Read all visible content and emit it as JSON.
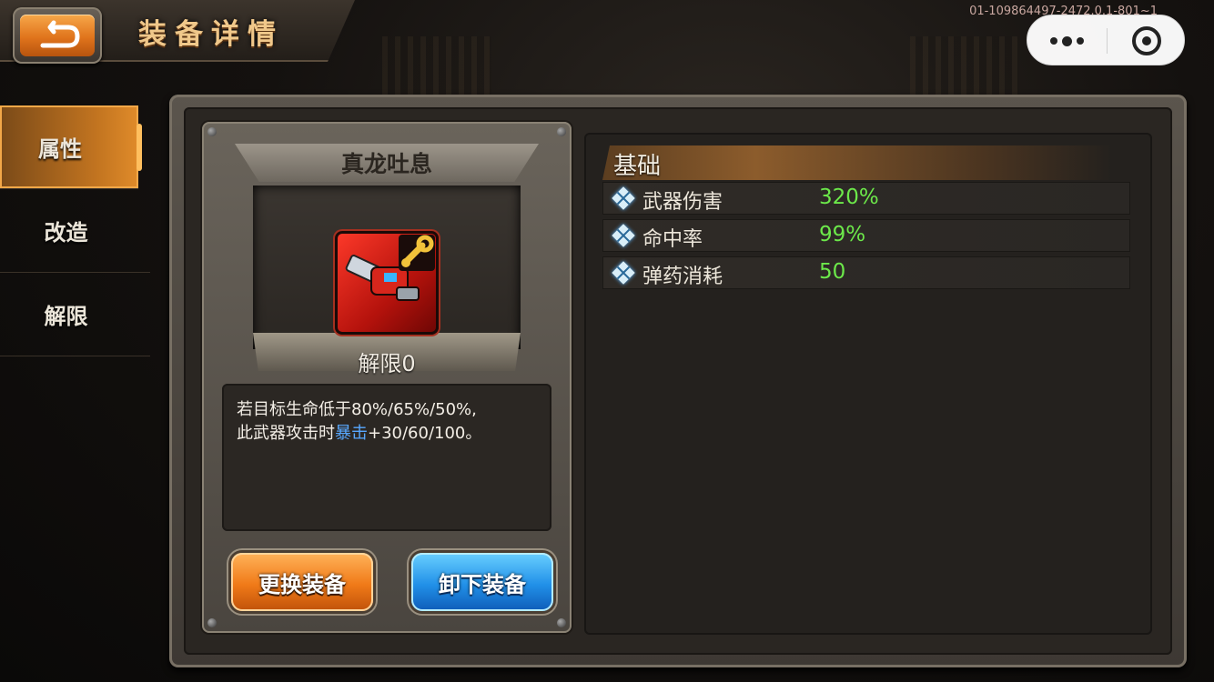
{
  "header": {
    "title": "装备详情",
    "back_icon": "back-arrow-icon",
    "build_id": "01-109864497-2472.0.1-801~1"
  },
  "capsule": {
    "more_icon": "more-dots-icon",
    "close_icon": "target-circle-icon"
  },
  "sidebar": {
    "items": [
      {
        "label": "属性",
        "active": true
      },
      {
        "label": "改造",
        "active": false
      },
      {
        "label": "解限",
        "active": false
      }
    ]
  },
  "item": {
    "name": "真龙吐息",
    "icon": "red-gauntlet-weapon-icon",
    "badge_icon": "wrench-icon",
    "unlock_level": "解限0",
    "description_line1": "若目标生命低于80%/65%/50%,",
    "description_line2_prefix": "此武器攻击时",
    "description_highlight": "暴击",
    "description_line2_suffix": "+30/60/100。",
    "highlight_color": "#58a8ff"
  },
  "actions": {
    "replace_label": "更换装备",
    "unequip_label": "卸下装备"
  },
  "stats": {
    "section_title": "基础",
    "value_color": "#6ce84a",
    "rows": [
      {
        "label": "武器伤害",
        "value": "320%"
      },
      {
        "label": "命中率",
        "value": "99%"
      },
      {
        "label": "弹药消耗",
        "value": "50"
      }
    ]
  }
}
